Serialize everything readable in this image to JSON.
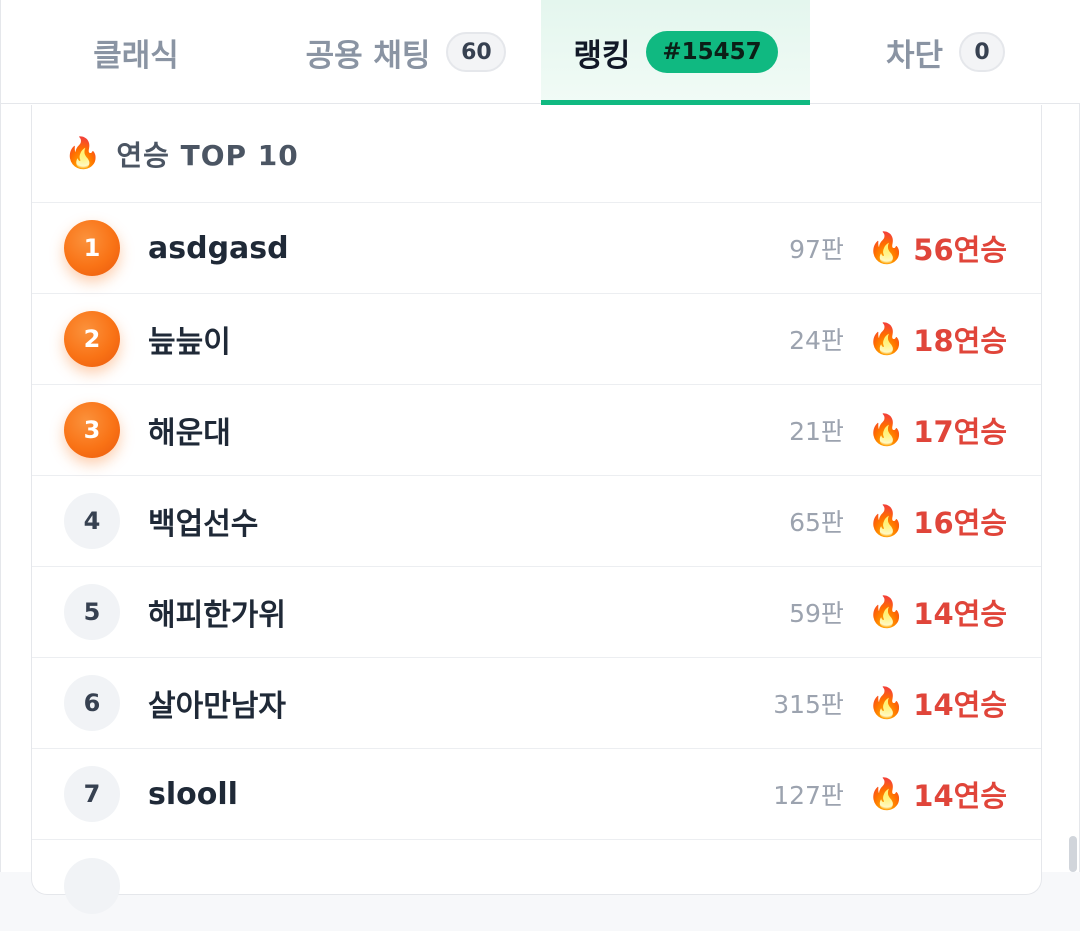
{
  "tabs": [
    {
      "label": "클래식",
      "badge": null
    },
    {
      "label": "공용 채팅",
      "badge": "60"
    },
    {
      "label": "랭킹",
      "badge": "#15457"
    },
    {
      "label": "차단",
      "badge": "0"
    }
  ],
  "active_tab": "랭킹",
  "ranking": {
    "title": "연승 TOP 10",
    "icon": "fire-icon",
    "rows": [
      {
        "rank": "1",
        "name": "asdgasd",
        "games": "97판",
        "streak": "56연승"
      },
      {
        "rank": "2",
        "name": "늪늪이",
        "games": "24판",
        "streak": "18연승"
      },
      {
        "rank": "3",
        "name": "해운대",
        "games": "21판",
        "streak": "17연승"
      },
      {
        "rank": "4",
        "name": "백업선수",
        "games": "65판",
        "streak": "16연승"
      },
      {
        "rank": "5",
        "name": "해피한가위",
        "games": "59판",
        "streak": "14연승"
      },
      {
        "rank": "6",
        "name": "살아만남자",
        "games": "315판",
        "streak": "14연승"
      },
      {
        "rank": "7",
        "name": "slooll",
        "games": "127판",
        "streak": "14연승"
      }
    ]
  },
  "colors": {
    "accent": "#10b981",
    "medal": "#f97316",
    "streak": "#e0453a"
  }
}
